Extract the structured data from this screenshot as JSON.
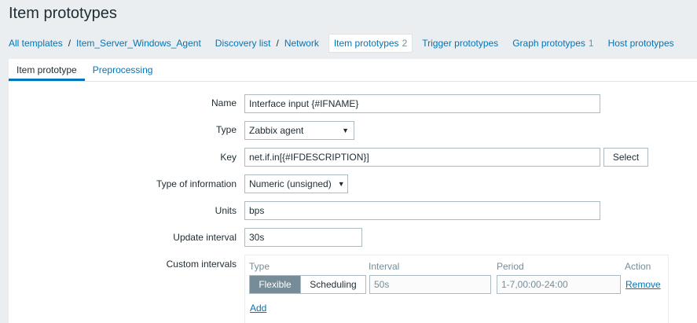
{
  "page": {
    "title": "Item prototypes"
  },
  "nav": {
    "all_templates": "All templates",
    "template": "Item_Server_Windows_Agent",
    "discovery_list": "Discovery list",
    "network": "Network",
    "item_prototypes": "Item prototypes",
    "item_prototypes_count": "2",
    "trigger_prototypes": "Trigger prototypes",
    "graph_prototypes": "Graph prototypes",
    "graph_prototypes_count": "1",
    "host_prototypes": "Host prototypes",
    "separator": "/"
  },
  "tabs": {
    "item_prototype": "Item prototype",
    "preprocessing": "Preprocessing"
  },
  "form": {
    "name_label": "Name",
    "name_value": "Interface input {#IFNAME}",
    "type_label": "Type",
    "type_value": "Zabbix agent",
    "key_label": "Key",
    "key_value": "net.if.in[{#IFDESCRIPTION}]",
    "select_button": "Select",
    "type_info_label": "Type of information",
    "type_info_value": "Numeric (unsigned)",
    "units_label": "Units",
    "units_value": "bps",
    "update_label": "Update interval",
    "update_value": "30s",
    "custom_label": "Custom intervals"
  },
  "custom_intervals": {
    "col_type": "Type",
    "col_interval": "Interval",
    "col_period": "Period",
    "col_action": "Action",
    "flexible": "Flexible",
    "scheduling": "Scheduling",
    "interval_value": "50s",
    "period_value": "1-7,00:00-24:00",
    "remove": "Remove",
    "add": "Add"
  },
  "icons": {
    "dropdown": "chevron-down-icon"
  }
}
